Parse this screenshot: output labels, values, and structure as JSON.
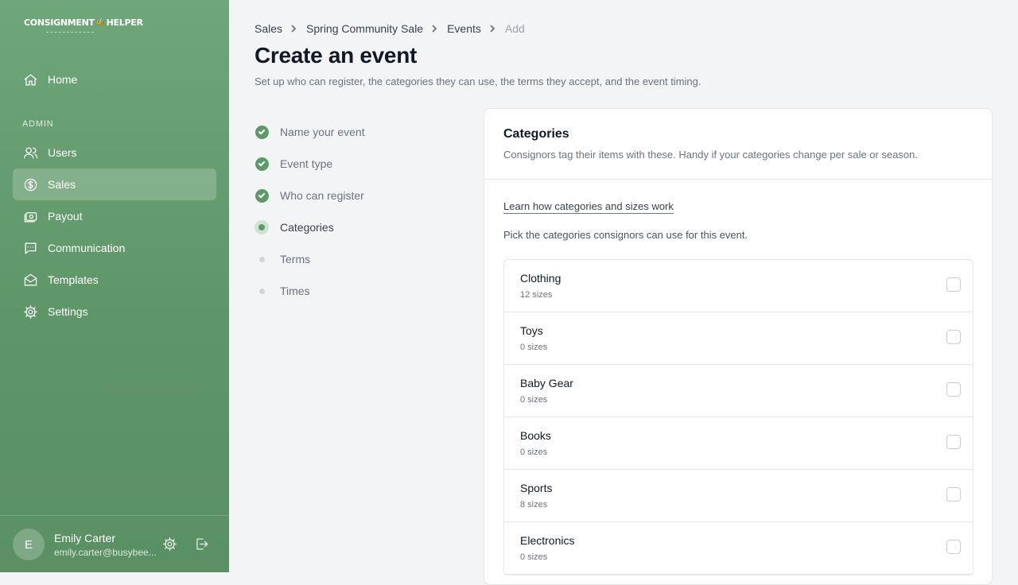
{
  "app": {
    "logo_left": "CONSIGNMENT",
    "logo_right": "HELPER"
  },
  "sidebar": {
    "home_label": "Home",
    "section_label": "ADMIN",
    "items": [
      {
        "label": "Users",
        "icon": "users-icon"
      },
      {
        "label": "Sales",
        "icon": "dollar-circle-icon",
        "active": true
      },
      {
        "label": "Payout",
        "icon": "payout-icon"
      },
      {
        "label": "Communication",
        "icon": "chat-icon"
      },
      {
        "label": "Templates",
        "icon": "mail-icon"
      },
      {
        "label": "Settings",
        "icon": "gear-icon"
      }
    ],
    "user": {
      "initial": "E",
      "name": "Emily Carter",
      "email": "emily.carter@busybee..."
    }
  },
  "breadcrumb": {
    "items": [
      "Sales",
      "Spring Community Sale",
      "Events"
    ],
    "current": "Add"
  },
  "header": {
    "title": "Create an event",
    "subtitle": "Set up who can register, the categories they can use, the terms they accept, and the event timing."
  },
  "steps": [
    {
      "label": "Name your event",
      "status": "complete"
    },
    {
      "label": "Event type",
      "status": "complete"
    },
    {
      "label": "Who can register",
      "status": "complete"
    },
    {
      "label": "Categories",
      "status": "current"
    },
    {
      "label": "Terms",
      "status": "pending"
    },
    {
      "label": "Times",
      "status": "pending"
    }
  ],
  "card": {
    "title": "Categories",
    "description": "Consignors tag their items with these. Handy if your categories change per sale or season.",
    "learn_link": "Learn how categories and sizes work",
    "pick_text": "Pick the categories consignors can use for this event."
  },
  "categories": [
    {
      "name": "Clothing",
      "sizes": "12 sizes",
      "checked": false
    },
    {
      "name": "Toys",
      "sizes": "0 sizes",
      "checked": false
    },
    {
      "name": "Baby Gear",
      "sizes": "0 sizes",
      "checked": false
    },
    {
      "name": "Books",
      "sizes": "0 sizes",
      "checked": false
    },
    {
      "name": "Sports",
      "sizes": "8 sizes",
      "checked": false
    },
    {
      "name": "Electronics",
      "sizes": "0 sizes",
      "checked": false
    }
  ],
  "colors": {
    "sidebar": "#6fa67a",
    "accent": "#5d9a69",
    "background": "#f3f4f6"
  }
}
